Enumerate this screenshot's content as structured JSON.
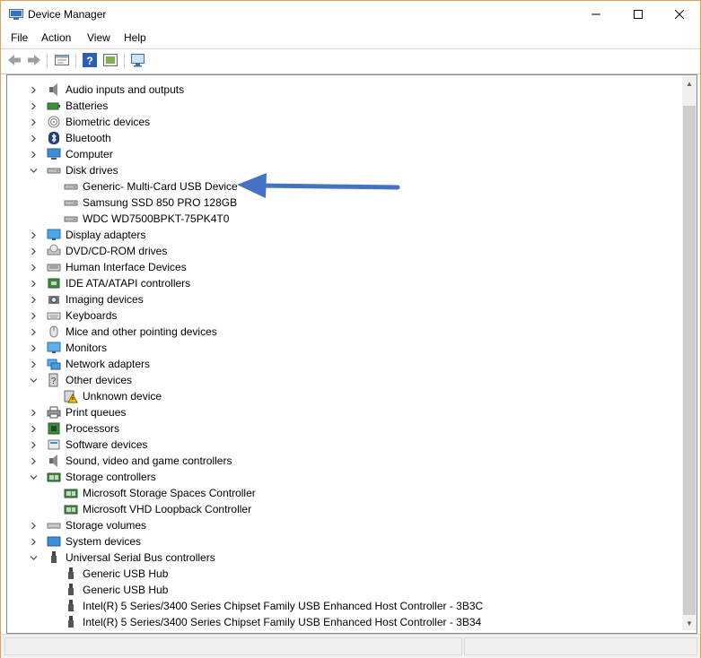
{
  "window": {
    "title": "Device Manager"
  },
  "menu": [
    "File",
    "Action",
    "View",
    "Help"
  ],
  "toolbar": [
    "back-icon",
    "forward-icon",
    "properties-icon",
    "help-icon",
    "update-driver-icon",
    "scan-hardware-icon"
  ],
  "tree": [
    {
      "label": "Audio inputs and outputs",
      "level": 0,
      "state": "collapsed",
      "icon": "speaker-icon"
    },
    {
      "label": "Batteries",
      "level": 0,
      "state": "collapsed",
      "icon": "battery-icon"
    },
    {
      "label": "Biometric devices",
      "level": 0,
      "state": "collapsed",
      "icon": "fingerprint-icon"
    },
    {
      "label": "Bluetooth",
      "level": 0,
      "state": "collapsed",
      "icon": "bluetooth-icon"
    },
    {
      "label": "Computer",
      "level": 0,
      "state": "collapsed",
      "icon": "computer-icon"
    },
    {
      "label": "Disk drives",
      "level": 0,
      "state": "expanded",
      "icon": "disk-drive-icon"
    },
    {
      "label": "Generic- Multi-Card USB Device",
      "level": 1,
      "state": "leaf",
      "icon": "disk-drive-icon"
    },
    {
      "label": "Samsung SSD 850 PRO 128GB",
      "level": 1,
      "state": "leaf",
      "icon": "disk-drive-icon"
    },
    {
      "label": "WDC WD7500BPKT-75PK4T0",
      "level": 1,
      "state": "leaf",
      "icon": "disk-drive-icon"
    },
    {
      "label": "Display adapters",
      "level": 0,
      "state": "collapsed",
      "icon": "display-icon"
    },
    {
      "label": "DVD/CD-ROM drives",
      "level": 0,
      "state": "collapsed",
      "icon": "dvd-icon"
    },
    {
      "label": "Human Interface Devices",
      "level": 0,
      "state": "collapsed",
      "icon": "hid-icon"
    },
    {
      "label": "IDE ATA/ATAPI controllers",
      "level": 0,
      "state": "collapsed",
      "icon": "ide-controller-icon"
    },
    {
      "label": "Imaging devices",
      "level": 0,
      "state": "collapsed",
      "icon": "camera-icon"
    },
    {
      "label": "Keyboards",
      "level": 0,
      "state": "collapsed",
      "icon": "keyboard-icon"
    },
    {
      "label": "Mice and other pointing devices",
      "level": 0,
      "state": "collapsed",
      "icon": "mouse-icon"
    },
    {
      "label": "Monitors",
      "level": 0,
      "state": "collapsed",
      "icon": "monitor-icon"
    },
    {
      "label": "Network adapters",
      "level": 0,
      "state": "collapsed",
      "icon": "network-icon"
    },
    {
      "label": "Other devices",
      "level": 0,
      "state": "expanded",
      "icon": "unknown-device-icon"
    },
    {
      "label": "Unknown device",
      "level": 1,
      "state": "leaf",
      "icon": "warning-icon"
    },
    {
      "label": "Print queues",
      "level": 0,
      "state": "collapsed",
      "icon": "printer-icon"
    },
    {
      "label": "Processors",
      "level": 0,
      "state": "collapsed",
      "icon": "processor-icon"
    },
    {
      "label": "Software devices",
      "level": 0,
      "state": "collapsed",
      "icon": "software-device-icon"
    },
    {
      "label": "Sound, video and game controllers",
      "level": 0,
      "state": "collapsed",
      "icon": "speaker-icon"
    },
    {
      "label": "Storage controllers",
      "level": 0,
      "state": "expanded",
      "icon": "storage-controller-icon"
    },
    {
      "label": "Microsoft Storage Spaces Controller",
      "level": 1,
      "state": "leaf",
      "icon": "storage-controller-icon"
    },
    {
      "label": "Microsoft VHD Loopback Controller",
      "level": 1,
      "state": "leaf",
      "icon": "storage-controller-icon"
    },
    {
      "label": "Storage volumes",
      "level": 0,
      "state": "collapsed",
      "icon": "storage-volume-icon"
    },
    {
      "label": "System devices",
      "level": 0,
      "state": "collapsed",
      "icon": "system-device-icon"
    },
    {
      "label": "Universal Serial Bus controllers",
      "level": 0,
      "state": "expanded",
      "icon": "usb-icon"
    },
    {
      "label": "Generic USB Hub",
      "level": 1,
      "state": "leaf",
      "icon": "usb-icon"
    },
    {
      "label": "Generic USB Hub",
      "level": 1,
      "state": "leaf",
      "icon": "usb-icon"
    },
    {
      "label": "Intel(R) 5 Series/3400 Series Chipset Family USB Enhanced Host Controller - 3B3C",
      "level": 1,
      "state": "leaf",
      "icon": "usb-icon"
    },
    {
      "label": "Intel(R) 5 Series/3400 Series Chipset Family USB Enhanced Host Controller - 3B34",
      "level": 1,
      "state": "leaf",
      "icon": "usb-icon"
    }
  ],
  "colors": {
    "annotation_arrow": "#4472c4",
    "window_border": "#e1a054"
  }
}
